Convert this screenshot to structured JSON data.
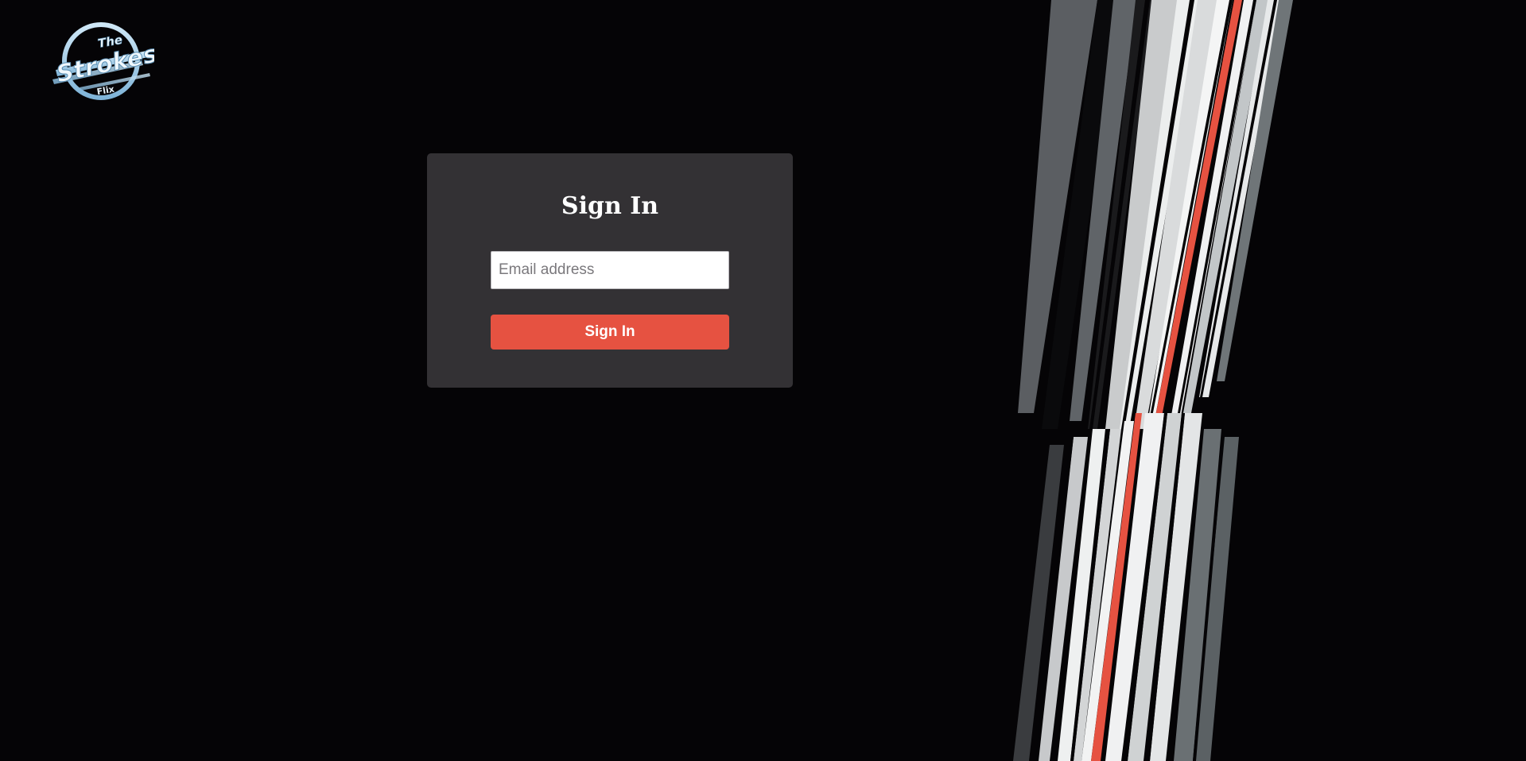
{
  "brand": {
    "logo_text_top": "The",
    "logo_text_main": "Strokes",
    "logo_text_sub": "Flix",
    "logo_color": "#9ecbe6"
  },
  "signin": {
    "title": "Sign In",
    "email_placeholder": "Email address",
    "email_value": "",
    "button_label": "Sign In"
  },
  "colors": {
    "background": "#050406",
    "card": "#333134",
    "accent": "#e65241",
    "input_bg": "#ffffff"
  },
  "decor": {
    "stripe_art": "diagonal-stripes",
    "stripe_accent": "#e65241"
  }
}
